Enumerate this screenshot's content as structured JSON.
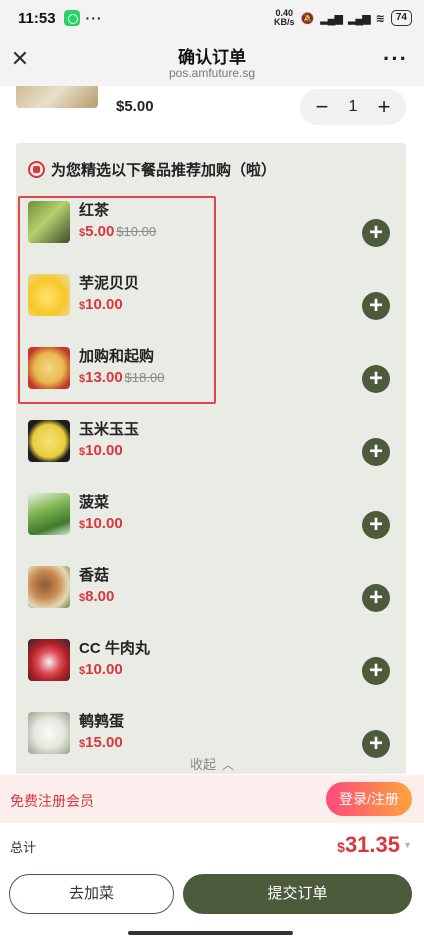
{
  "status_bar": {
    "time": "11:53",
    "net_speed_value": "0.40",
    "net_speed_unit": "KB/s",
    "battery": "74"
  },
  "header": {
    "title": "确认订单",
    "url": "pos.amfuture.sg"
  },
  "cart_item": {
    "price": "$5.00",
    "quantity": "1",
    "minus": "−",
    "plus": "+"
  },
  "recommendations": {
    "heading": "为您精选以下餐品推荐加购（啦）",
    "currency": "$",
    "items": [
      {
        "name": "红茶",
        "price": "5.00",
        "original_price": "$10.00"
      },
      {
        "name": "芋泥贝贝",
        "price": "10.00",
        "original_price": ""
      },
      {
        "name": "加购和起购",
        "price": "13.00",
        "original_price": "$18.00"
      },
      {
        "name": "玉米玉玉",
        "price": "10.00",
        "original_price": ""
      },
      {
        "name": "菠菜",
        "price": "10.00",
        "original_price": ""
      },
      {
        "name": "香菇",
        "price": "8.00",
        "original_price": ""
      },
      {
        "name": "CC 牛肉丸",
        "price": "10.00",
        "original_price": ""
      },
      {
        "name": "鹌鹑蛋",
        "price": "15.00",
        "original_price": ""
      }
    ],
    "collapse_label": "收起"
  },
  "member": {
    "text": "免费注册会员",
    "button": "登录/注册"
  },
  "total": {
    "label": "总计",
    "currency": "$",
    "amount": "31.35"
  },
  "actions": {
    "add_more": "去加菜",
    "submit": "提交订单"
  },
  "colors": {
    "accent": "#4d5a3c",
    "price_red": "#d9363e",
    "highlight_border": "#e2444f"
  }
}
